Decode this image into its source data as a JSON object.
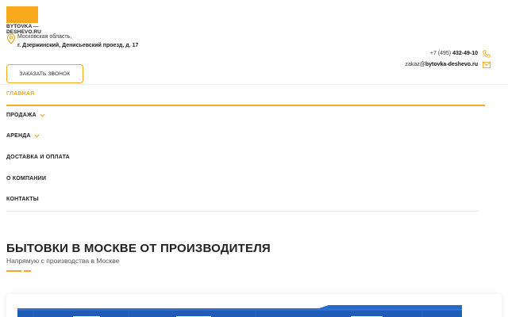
{
  "brand": {
    "logo_line1": "BYTOVKA —",
    "logo_line2": "DESHEVO.RU",
    "accent_color": "#f7a81b"
  },
  "header": {
    "address_line1": "Московская область,",
    "address_line2": "г. Дзержинский, Денисьевский проезд, д. 17",
    "phone_prefix": "+7 (495) ",
    "phone_number": "432-49-10",
    "email_user": "zakaz@",
    "email_domain": "bytovka-deshevo.ru",
    "call_button_label": "ЗАКАЗАТЬ ЗВОНОК"
  },
  "nav": {
    "items": [
      {
        "label": "ГЛАВНАЯ",
        "active": true,
        "has_dropdown": false
      },
      {
        "label": "ПРОДАЖА",
        "active": false,
        "has_dropdown": true
      },
      {
        "label": "АРЕНДА",
        "active": false,
        "has_dropdown": true
      },
      {
        "label": "ДОСТАВКА И ОПЛАТА",
        "active": false,
        "has_dropdown": false
      },
      {
        "label": "О КОМПАНИИ",
        "active": false,
        "has_dropdown": false
      },
      {
        "label": "КОНТАКТЫ",
        "active": false,
        "has_dropdown": false
      }
    ]
  },
  "hero": {
    "title": "БЫТОВКИ В МОСКВЕ ОТ ПРОИЗВОДИТЕЛЯ",
    "subtitle": "Напрямую с производства в Москве"
  },
  "icons": {
    "address": "location-pin-icon",
    "phone": "phone-icon",
    "email": "mail-icon",
    "dropdown": "chevron-down-icon"
  }
}
